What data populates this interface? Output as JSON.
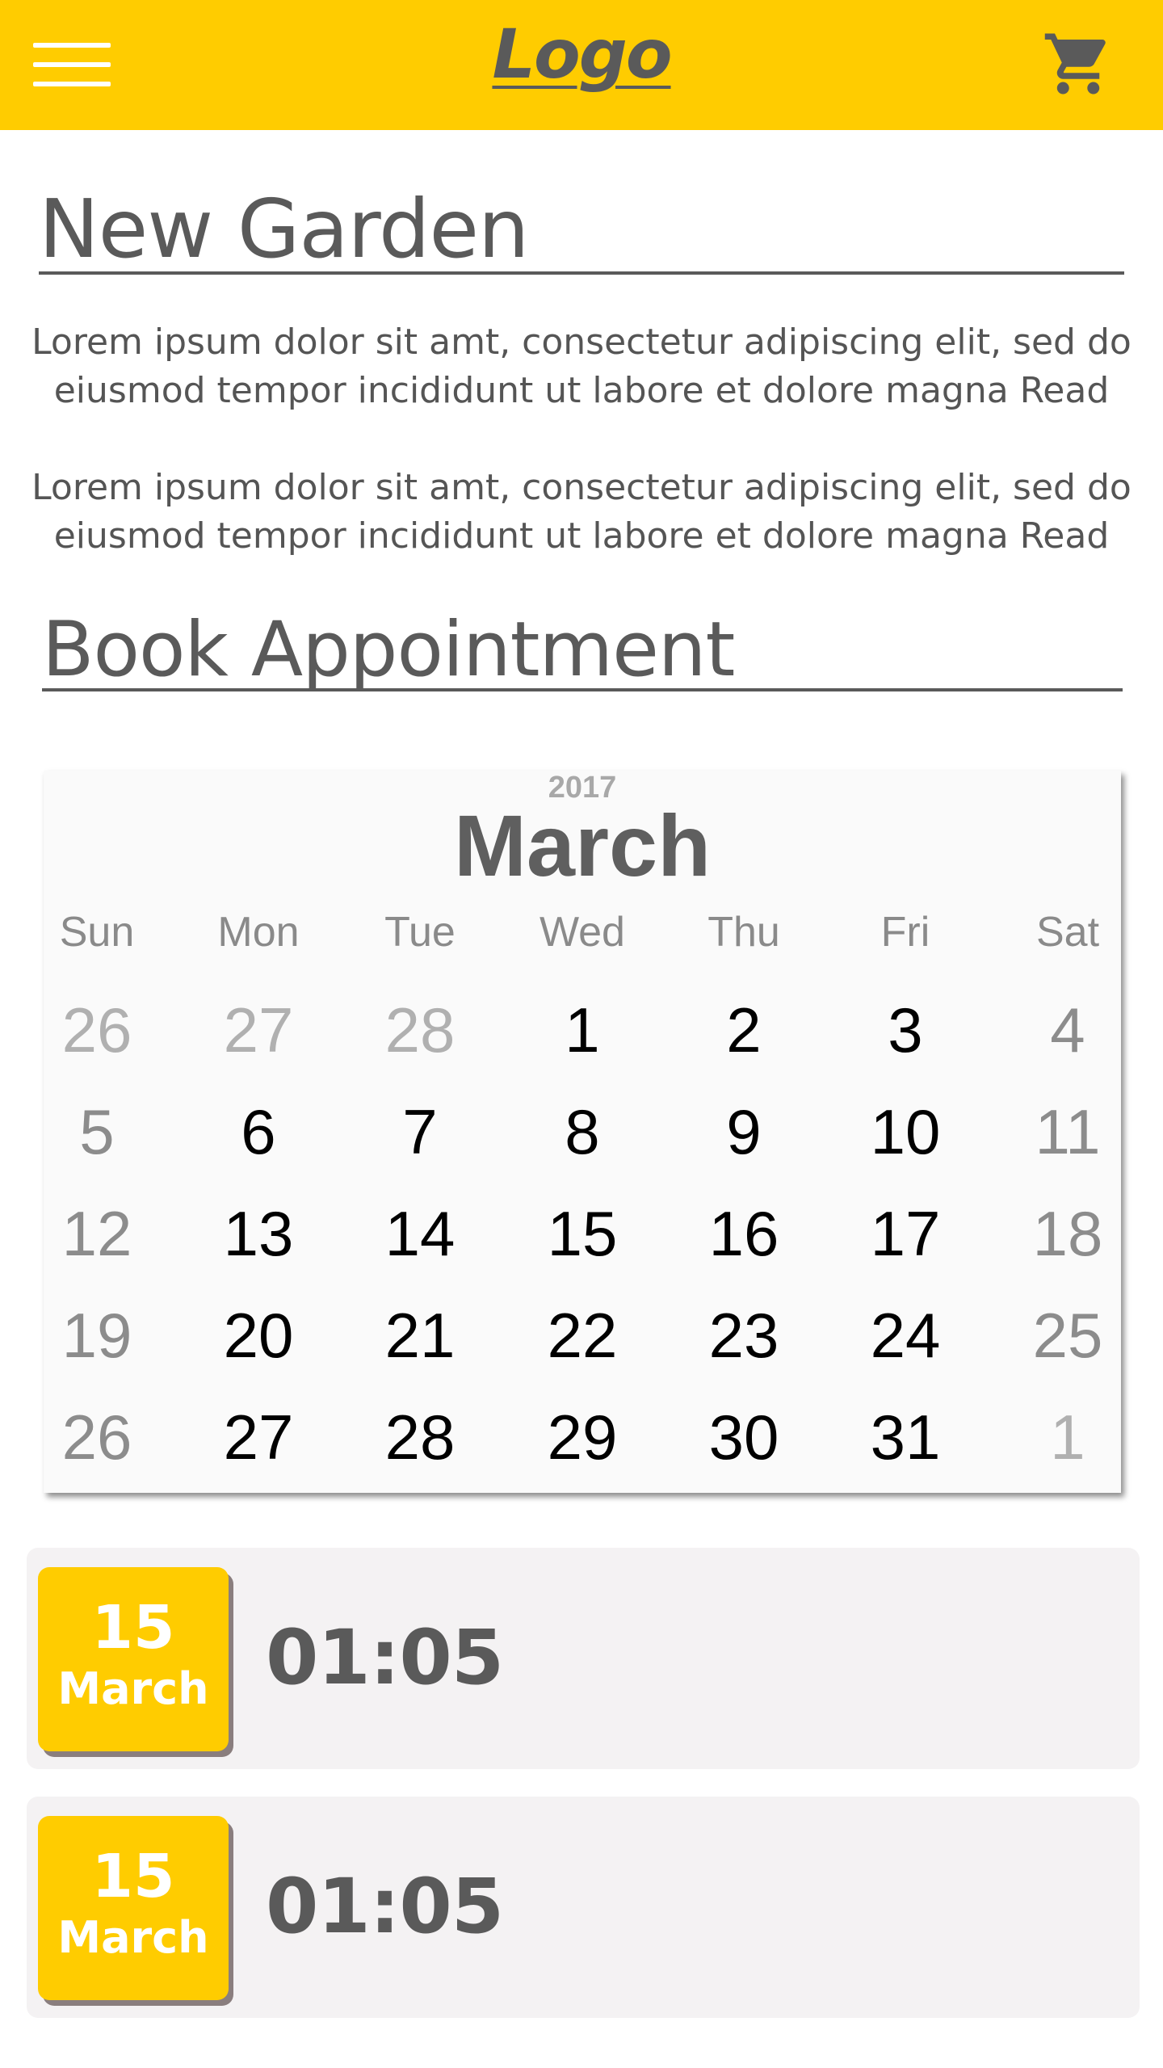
{
  "header": {
    "logo": "Logo",
    "menu_icon": "hamburger-menu-icon",
    "cart_icon": "shopping-cart-icon",
    "background_color": "#FFCC00"
  },
  "intro": {
    "title": "New Garden",
    "paragraphs": [
      {
        "line1": "Lorem ipsum dolor sit amt, consectetur adipiscing elit, sed do",
        "line2": "eiusmod tempor incididunt ut labore et dolore magna Read"
      },
      {
        "line1": "Lorem ipsum dolor sit amt, consectetur adipiscing elit, sed do",
        "line2": "eiusmod tempor incididunt ut labore et dolore magna Read"
      }
    ]
  },
  "booking": {
    "title": "Book Appointment",
    "calendar": {
      "year": "2017",
      "month": "March",
      "weekdays": [
        "Sun",
        "Mon",
        "Tue",
        "Wed",
        "Thu",
        "Fri",
        "Sat"
      ],
      "weeks": [
        [
          "26",
          "27",
          "28",
          "1",
          "2",
          "3",
          "4"
        ],
        [
          "5",
          "6",
          "7",
          "8",
          "9",
          "10",
          "11"
        ],
        [
          "12",
          "13",
          "14",
          "15",
          "16",
          "17",
          "18"
        ],
        [
          "19",
          "20",
          "21",
          "22",
          "23",
          "24",
          "25"
        ],
        [
          "26",
          "27",
          "28",
          "29",
          "30",
          "31",
          "1"
        ]
      ]
    },
    "appointments": [
      {
        "day": "15",
        "month": "March",
        "time": "01:05"
      },
      {
        "day": "15",
        "month": "March",
        "time": "01:05"
      }
    ]
  },
  "colors": {
    "accent": "#FFCC00",
    "text": "#5a5a5a",
    "card_background": "#f4f2f3"
  }
}
